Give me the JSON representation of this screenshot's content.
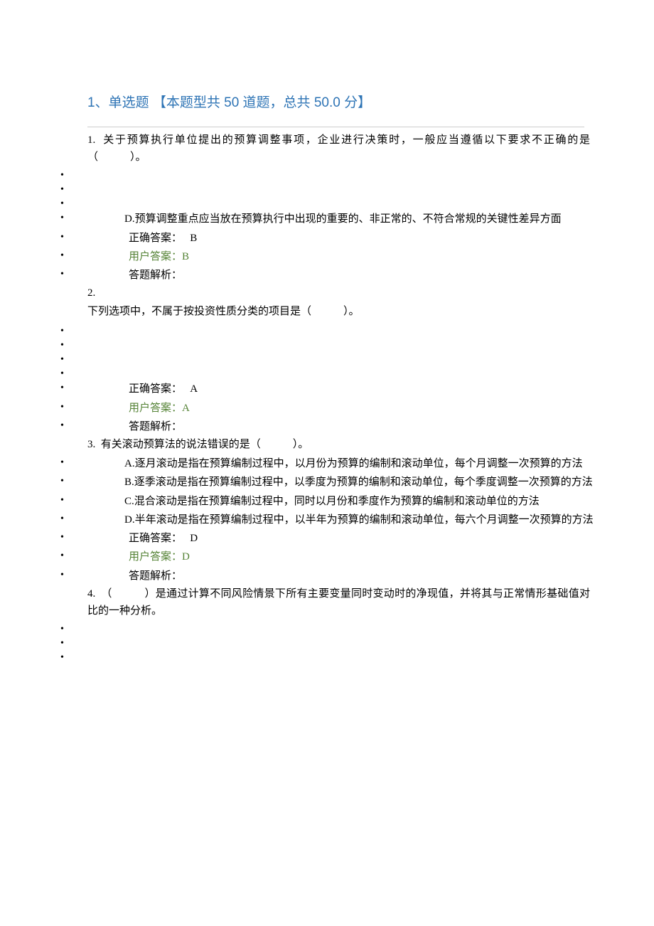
{
  "section": {
    "title": "1、单选题 【本题型共 50 道题，总共 50.0 分】"
  },
  "questions": [
    {
      "num": "1.",
      "text": "关于预算执行单位提出的预算调整事项，企业进行决策时，一般应当遵循以下要求不正确的是（　　　）。",
      "options": [
        {
          "letter": "",
          "text": ""
        },
        {
          "letter": "",
          "text": ""
        },
        {
          "letter": "",
          "text": ""
        },
        {
          "letter": "D.",
          "text": "预算调整重点应当放在预算执行中出现的重要的、非正常的、不符合常规的关键性差异方面"
        }
      ],
      "correct_label": "正确答案：",
      "correct_value": "B",
      "user_label": "用户答案：",
      "user_value": "B",
      "analysis_label": "答题解析："
    },
    {
      "num": "2.",
      "text": "下列选项中，不属于按投资性质分类的项目是（　　　）。",
      "options": [
        {
          "letter": "",
          "text": ""
        },
        {
          "letter": "",
          "text": ""
        },
        {
          "letter": "",
          "text": ""
        },
        {
          "letter": "",
          "text": ""
        }
      ],
      "correct_label": "正确答案：",
      "correct_value": "A",
      "user_label": "用户答案：",
      "user_value": "A",
      "analysis_label": "答题解析："
    },
    {
      "num": "3.",
      "text": "有关滚动预算法的说法错误的是（　　　）。",
      "options": [
        {
          "letter": "A.",
          "text": "逐月滚动是指在预算编制过程中，以月份为预算的编制和滚动单位，每个月调整一次预算的方法"
        },
        {
          "letter": "B.",
          "text": "逐季滚动是指在预算编制过程中，以季度为预算的编制和滚动单位，每个季度调整一次预算的方法"
        },
        {
          "letter": "C.",
          "text": "混合滚动是指在预算编制过程中，同时以月份和季度作为预算的编制和滚动单位的方法"
        },
        {
          "letter": "D.",
          "text": "半年滚动是指在预算编制过程中，以半年为预算的编制和滚动单位，每六个月调整一次预算的方法"
        }
      ],
      "correct_label": "正确答案：",
      "correct_value": "D",
      "user_label": "用户答案：",
      "user_value": "D",
      "analysis_label": "答题解析："
    },
    {
      "num": "4.",
      "text": "（　　　）是通过计算不同风险情景下所有主要变量同时变动时的净现值，并将其与正常情形基础值对比的一种分析。",
      "options": [
        {
          "letter": "",
          "text": ""
        },
        {
          "letter": "",
          "text": ""
        },
        {
          "letter": "",
          "text": ""
        }
      ]
    }
  ]
}
